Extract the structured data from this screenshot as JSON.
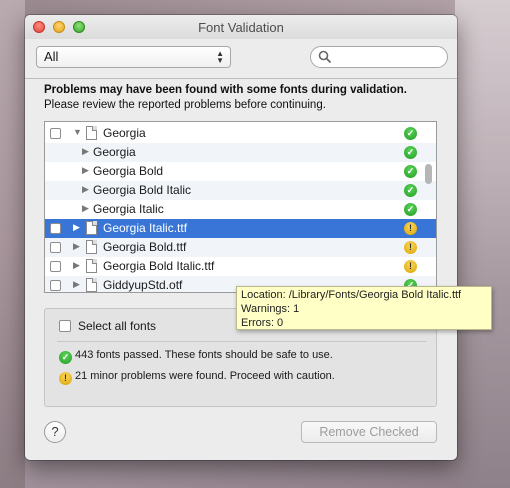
{
  "window": {
    "title": "Font Validation"
  },
  "toolbar": {
    "filter_value": "All",
    "search_placeholder": ""
  },
  "message": {
    "bold": "Problems may have been found with some fonts during validation.",
    "text": "Please review the reported problems before continuing."
  },
  "list": {
    "rows": [
      {
        "label": "Georgia",
        "status": "ok"
      },
      {
        "label": "Georgia",
        "status": "ok"
      },
      {
        "label": "Georgia Bold",
        "status": "ok"
      },
      {
        "label": "Georgia Bold Italic",
        "status": "ok"
      },
      {
        "label": "Georgia Italic",
        "status": "ok"
      },
      {
        "label": "Georgia Italic.ttf",
        "status": "warn",
        "selected": true
      },
      {
        "label": "Georgia Bold.ttf",
        "status": "warn"
      },
      {
        "label": "Georgia Bold Italic.ttf",
        "status": "warn"
      },
      {
        "label": "GiddyupStd.otf",
        "status": "ok"
      }
    ]
  },
  "tooltip": {
    "location": "Location: /Library/Fonts/Georgia Bold Italic.ttf",
    "warnings": "Warnings: 1",
    "errors": "Errors: 0"
  },
  "summary": {
    "select_all_label": "Select all fonts",
    "passed_text": "443 fonts passed. These fonts should be safe to use.",
    "problems_text": "21 minor problems were found. Proceed with caution."
  },
  "buttons": {
    "help": "?",
    "remove_checked": "Remove Checked"
  },
  "colors": {
    "selection": "#3875d7",
    "ok": "#1f9c24",
    "warning": "#d6a300",
    "tooltip_bg": "#ffffc6"
  }
}
